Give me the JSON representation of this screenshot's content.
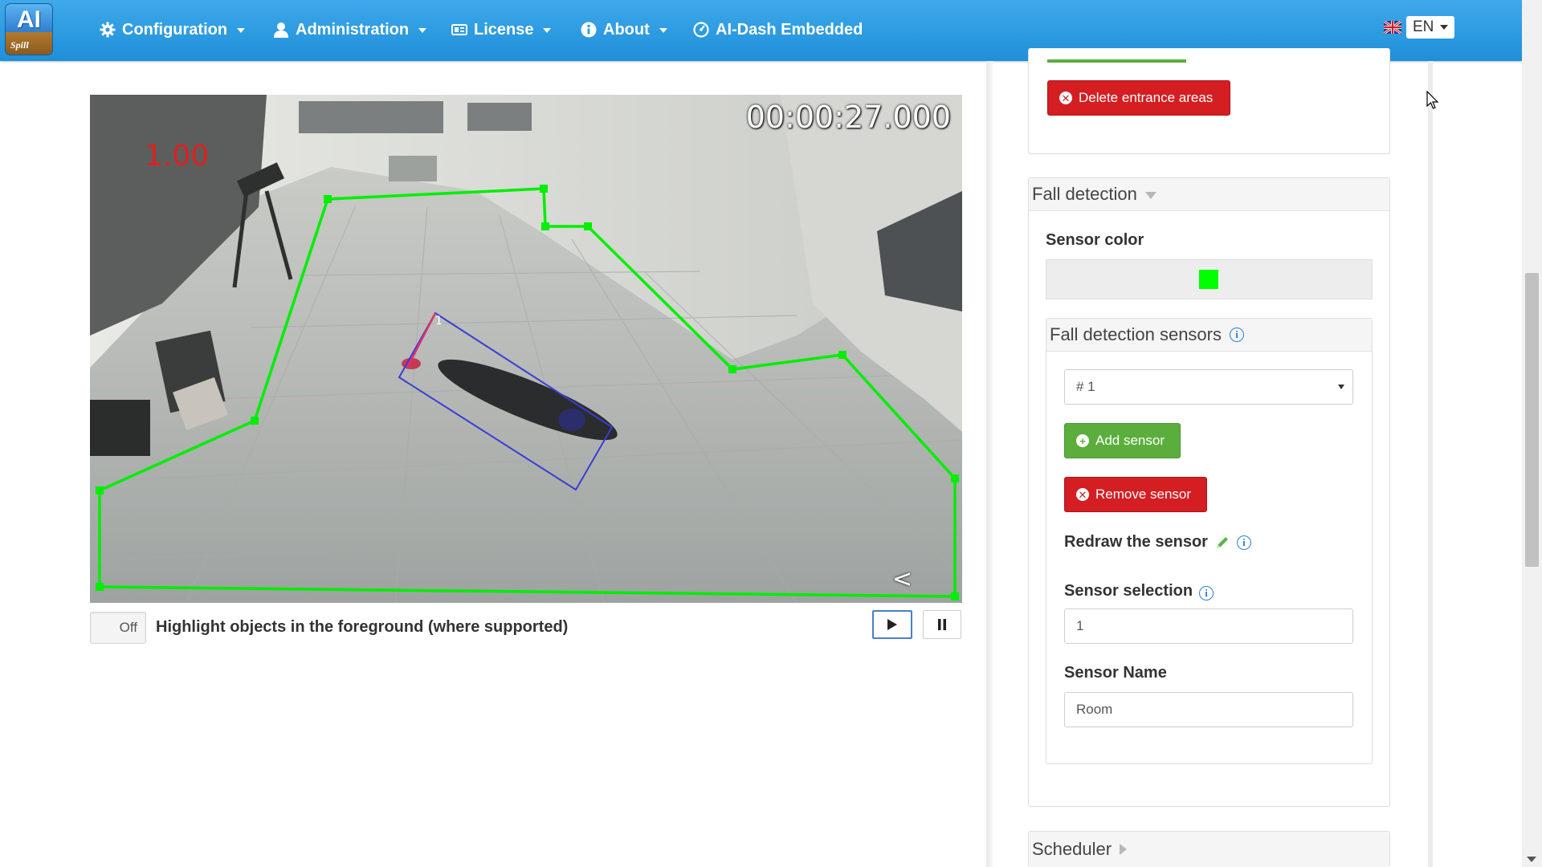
{
  "app": {
    "logo_text": "AI",
    "logo_subtext": "Spill"
  },
  "nav": {
    "items": [
      {
        "label": "Configuration",
        "icon": "gear-icon",
        "has_caret": true
      },
      {
        "label": "Administration",
        "icon": "user-icon",
        "has_caret": true
      },
      {
        "label": "License",
        "icon": "id-card-icon",
        "has_caret": true
      },
      {
        "label": "About",
        "icon": "info-circle-icon",
        "has_caret": true
      },
      {
        "label": "AI-Dash Embedded",
        "icon": "dashboard-icon",
        "has_caret": false
      }
    ],
    "language": {
      "flag": "uk-flag-icon",
      "value": "EN"
    }
  },
  "video": {
    "timecode": "00:00:27.000",
    "score": "1.00",
    "object_label": "1",
    "overlay_glyph": "<",
    "sensor_color": "#00ff00",
    "bbox_color": "#3b3bd6"
  },
  "player": {
    "toggle_value": "Off",
    "toggle_label": "Highlight objects in the foreground (where supported)",
    "play_icon": "play-icon",
    "pause_icon": "pause-icon"
  },
  "config": {
    "delete_entrance_label": "Delete entrance areas",
    "fall_detection": {
      "title": "Fall detection",
      "sensor_color_label": "Sensor color",
      "sensor_color": "#00ff00",
      "sensors_title": "Fall detection sensors",
      "selected_sensor": "# 1",
      "add_sensor_label": "Add sensor",
      "remove_sensor_label": "Remove sensor",
      "redraw_label": "Redraw the sensor",
      "sensor_selection_label": "Sensor selection",
      "sensor_selection_value": "1",
      "sensor_name_label": "Sensor Name",
      "sensor_name_value": "Room"
    },
    "scheduler_title": "Scheduler"
  },
  "colors": {
    "navbar": "#2a9be2",
    "danger": "#d41e22",
    "success": "#5bae3c",
    "info": "#2d7fd4"
  }
}
